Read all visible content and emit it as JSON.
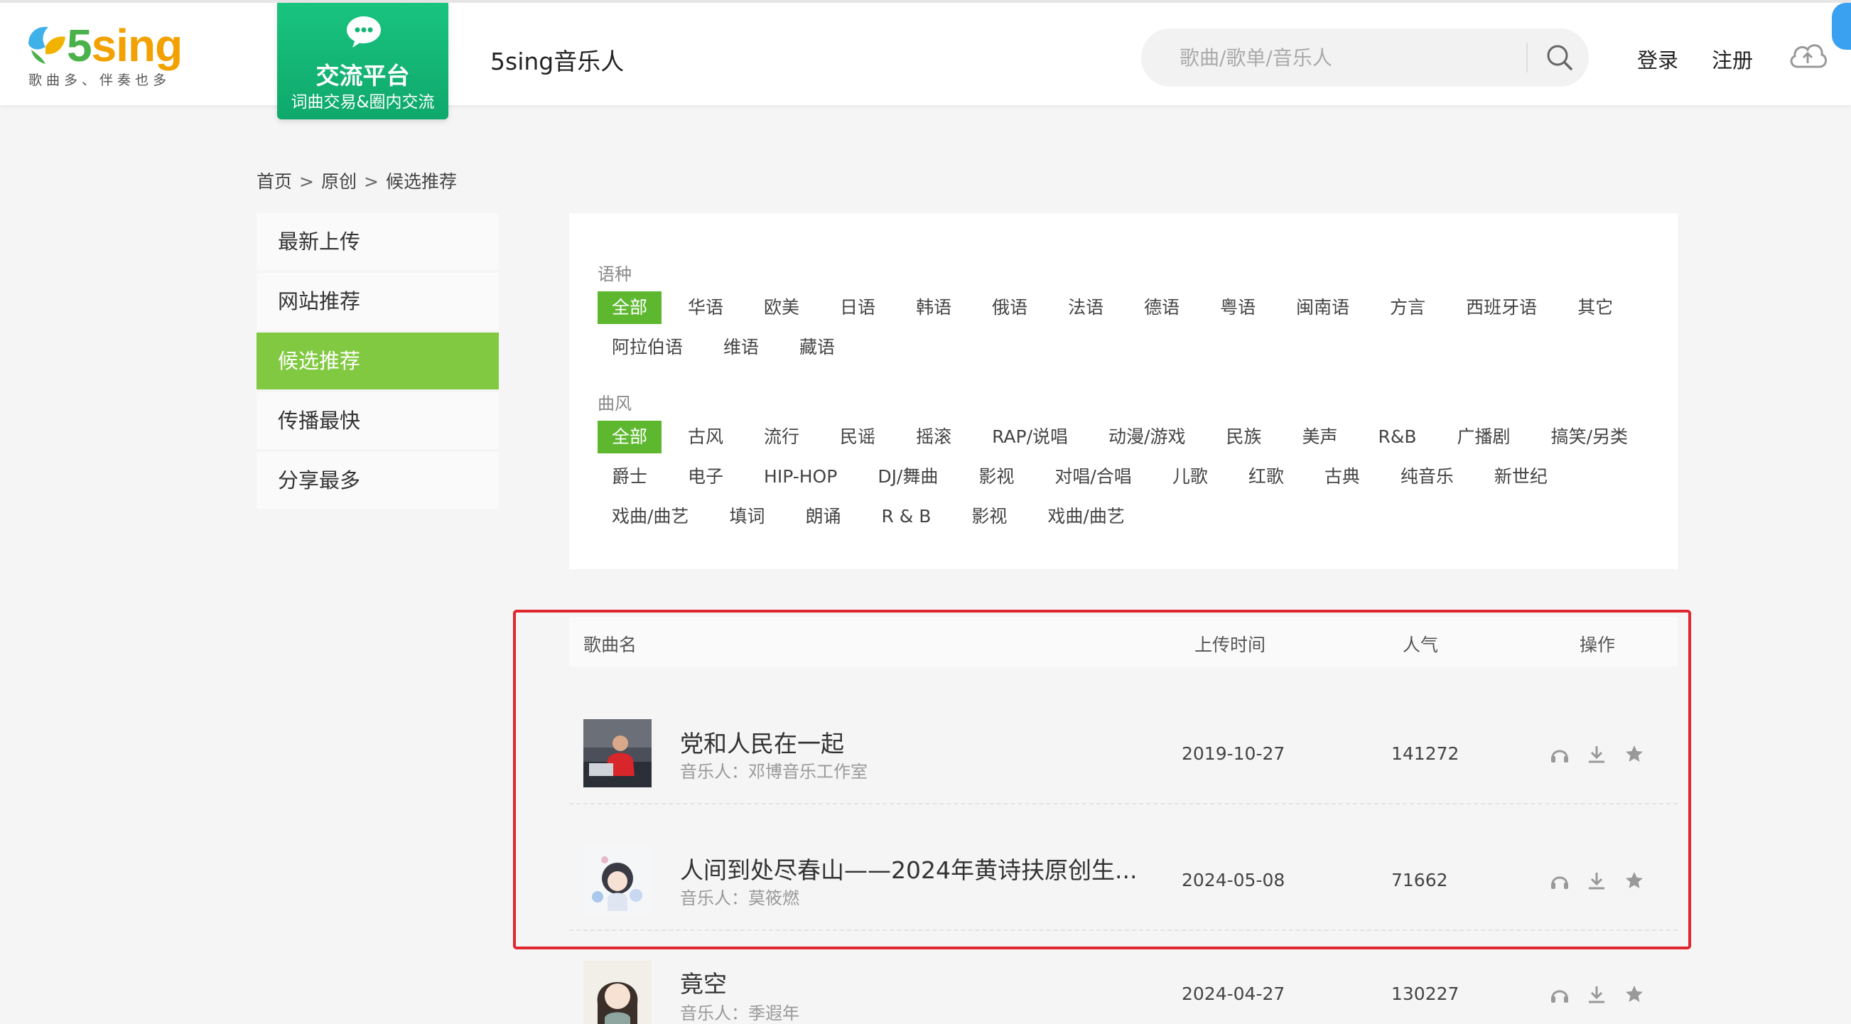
{
  "header": {
    "logo_text_5": "5",
    "logo_text_sing": "sing",
    "logo_slogan": "歌曲多、伴奏也多",
    "promo_title": "交流平台",
    "promo_subtitle": "词曲交易&圈内交流",
    "site_title": "5sing音乐人",
    "search_placeholder": "歌曲/歌单/音乐人",
    "login": "登录",
    "register": "注册"
  },
  "breadcrumb": [
    "首页",
    "原创",
    "候选推荐"
  ],
  "breadcrumb_sep": ">",
  "sidebar": {
    "items": [
      {
        "label": "最新上传",
        "active": false
      },
      {
        "label": "网站推荐",
        "active": false
      },
      {
        "label": "候选推荐",
        "active": true
      },
      {
        "label": "传播最快",
        "active": false
      },
      {
        "label": "分享最多",
        "active": false
      }
    ]
  },
  "filters": {
    "language_label": "语种",
    "language_rows": [
      [
        "全部",
        "华语",
        "欧美",
        "日语",
        "韩语",
        "俄语",
        "法语",
        "德语",
        "粤语",
        "闽南语",
        "方言",
        "西班牙语",
        "其它"
      ],
      [
        "阿拉伯语",
        "维语",
        "藏语"
      ]
    ],
    "style_label": "曲风",
    "style_rows": [
      [
        "全部",
        "古风",
        "流行",
        "民谣",
        "摇滚",
        "RAP/说唱",
        "动漫/游戏",
        "民族",
        "美声",
        "R&B",
        "广播剧",
        "搞笑/另类"
      ],
      [
        "爵士",
        "电子",
        "HIP-HOP",
        "DJ/舞曲",
        "影视",
        "对唱/合唱",
        "儿歌",
        "红歌",
        "古典",
        "纯音乐",
        "新世纪"
      ],
      [
        "戏曲/曲艺",
        "填词",
        "朗诵",
        "R & B",
        "影视",
        "戏曲/曲艺"
      ]
    ],
    "active_language": "全部",
    "active_style": "全部"
  },
  "table": {
    "columns": {
      "name": "歌曲名",
      "upload_time": "上传时间",
      "popularity": "人气",
      "actions": "操作"
    },
    "artist_prefix": "音乐人：",
    "rows": [
      {
        "title": "党和人民在一起",
        "artist": "邓博音乐工作室",
        "date": "2019-10-27",
        "popularity": "141272"
      },
      {
        "title": "人间到处尽春山——2024年黄诗扶原创生...",
        "artist": "莫筱燃",
        "date": "2024-05-08",
        "popularity": "71662"
      },
      {
        "title": "竟空",
        "artist": "季遐年",
        "date": "2024-04-27",
        "popularity": "130227"
      }
    ]
  },
  "colors": {
    "accent_green": "#82c942",
    "tag_active_green": "#5eb82f",
    "promo_green": "#12b574",
    "highlight_red": "#e0262f"
  }
}
